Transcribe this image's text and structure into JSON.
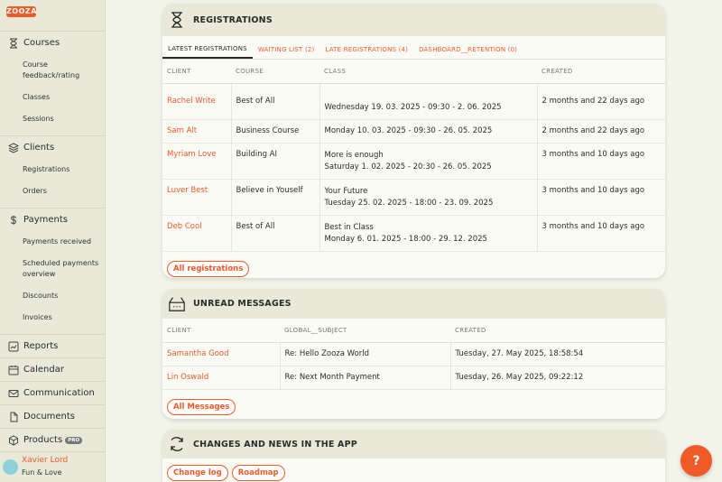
{
  "brand": {
    "logo_text": "ZOOZA",
    "accent": "#f05a28"
  },
  "sidebar": {
    "sections": [
      {
        "label": "Courses",
        "icon": "hourglass-icon"
      },
      {
        "label": "Clients",
        "icon": "layers-icon"
      },
      {
        "label": "Payments",
        "icon": "dollar-icon"
      },
      {
        "label": "Reports",
        "icon": "chart-icon"
      },
      {
        "label": "Calendar",
        "icon": "calendar-icon"
      },
      {
        "label": "Communication",
        "icon": "mail-icon"
      },
      {
        "label": "Documents",
        "icon": "document-icon"
      },
      {
        "label": "Products",
        "icon": "box-icon",
        "badge": "PRO"
      }
    ],
    "courses_items": [
      "Course feedback/rating",
      "Classes",
      "Sessions"
    ],
    "clients_items": [
      "Registrations",
      "Orders"
    ],
    "payments_items": [
      "Payments received",
      "Scheduled payments overview",
      "Discounts",
      "Invoices"
    ],
    "user": {
      "name": "Xavier Lord",
      "org": "Fun & Love"
    }
  },
  "registrations": {
    "title": "REGISTRATIONS",
    "tabs": [
      "LATEST REGISTRATIONS",
      "WAITING LIST (2)",
      "LATE REGISTRATIONS (4)",
      "DASHBOARD__RETENTION (0)"
    ],
    "columns": [
      "CLIENT",
      "COURSE",
      "CLASS",
      "CREATED"
    ],
    "rows": [
      {
        "client": "Rachel Write",
        "course": "Best of All",
        "class_name": "",
        "class_date": "Wednesday 19. 03. 2025 - 09:30 - 2. 06. 2025",
        "created": "2 months and 22 days ago"
      },
      {
        "client": "Sam Alt",
        "course": "Business Course",
        "class_name": "",
        "class_date": "Monday 10. 03. 2025 - 09:30 - 26. 05. 2025",
        "created": "2 months and 22 days ago"
      },
      {
        "client": "Myriam Love",
        "course": "Building AI",
        "class_name": "More is enough",
        "class_date": "Saturday 1. 02. 2025 - 20:30 - 26. 05. 2025",
        "created": "3 months and 10 days ago"
      },
      {
        "client": "Luver Best",
        "course": "Believe in Youself",
        "class_name": "Your Future",
        "class_date": "Tuesday 25. 02. 2025 - 18:00 - 23. 09. 2025",
        "created": "3 months and 10 days ago"
      },
      {
        "client": "Deb Cool",
        "course": "Best of All",
        "class_name": "Best in Class",
        "class_date": "Monday 6. 01. 2025 - 18:00 - 29. 12. 2025",
        "created": "3 months and 10 days ago"
      }
    ],
    "all_button": "All registrations"
  },
  "messages": {
    "title": "UNREAD MESSAGES",
    "columns": [
      "CLIENT",
      "GLOBAL__SUBJECT",
      "CREATED"
    ],
    "rows": [
      {
        "client": "Samantha Good",
        "subject": "Re: Hello Zooza World",
        "created": "Tuesday, 27. May 2025, 18:58:54"
      },
      {
        "client": "Lin Oswald",
        "subject": "Re: Next Month Payment",
        "created": "Tuesday, 26. May 2025, 09:22:12"
      }
    ],
    "all_button": "All Messages"
  },
  "news": {
    "title": "CHANGES AND NEWS IN THE APP",
    "buttons": [
      "Change log",
      "Roadmap"
    ]
  },
  "help": {
    "label": "?"
  }
}
